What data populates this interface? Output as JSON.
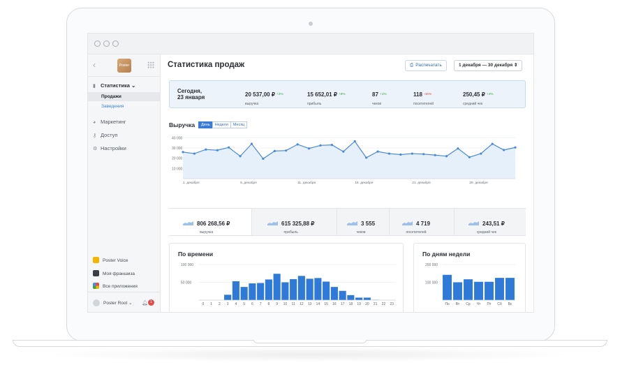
{
  "sidebar": {
    "back_glyph": "‹",
    "logo_text": "Poster",
    "nav": [
      {
        "label": "Статистика ⌄",
        "icon": "bar-chart-icon"
      },
      {
        "label": "Маркетинг",
        "icon": "marketing-icon"
      },
      {
        "label": "Доступ",
        "icon": "key-icon"
      },
      {
        "label": "Настройки",
        "icon": "gear-icon"
      }
    ],
    "sub_items": [
      "Продажи",
      "Заведения"
    ],
    "bottom": [
      {
        "label": "Poster Voice",
        "color": "#f5b400"
      },
      {
        "label": "Моя франшиза",
        "color": "#3a3f46"
      },
      {
        "label": "Все приложения",
        "color": "#4a8de0"
      }
    ],
    "user": "Poster Root ⌄",
    "notifications": "1"
  },
  "header": {
    "title": "Статистика продаж",
    "print_label": "Распечатать",
    "date_range": "1 декабря — 30 декабря ⇕"
  },
  "summary": {
    "today": [
      "Сегодня,",
      "23 января"
    ],
    "items": [
      {
        "value": "20 537,00 ₽",
        "pct": "+2%",
        "label": "выручка",
        "up": true
      },
      {
        "value": "15 652,01 ₽",
        "pct": "+8%",
        "label": "прибыль",
        "up": true
      },
      {
        "value": "87",
        "pct": "+1%",
        "label": "чеков",
        "up": true
      },
      {
        "value": "118",
        "pct": "-45%",
        "label": "посетителей",
        "up": false
      },
      {
        "value": "250,45 ₽",
        "pct": "+4%",
        "label": "средний чек",
        "up": true
      }
    ]
  },
  "revenue": {
    "title": "Выручка",
    "tabs": [
      "День",
      "Неделя",
      "Месяц"
    ],
    "active_tab": 0
  },
  "kpis": [
    {
      "value": "806 268,56 ₽",
      "label": "выручка"
    },
    {
      "value": "615 325,88 ₽",
      "label": "прибыль"
    },
    {
      "value": "3 555",
      "label": "чеков"
    },
    {
      "value": "4 719",
      "label": "посетителей"
    },
    {
      "value": "243,51 ₽",
      "label": "средний чек"
    }
  ],
  "colors": {
    "accent": "#3a7bd5",
    "line": "#4a8ad8",
    "area": "#e6f0fb",
    "bar": "#2f7ad8",
    "up": "#39a845",
    "down": "#e34b4b"
  },
  "chart_data": [
    {
      "type": "area",
      "title": "Выручка",
      "x": [
        1,
        2,
        3,
        4,
        5,
        6,
        7,
        8,
        9,
        10,
        11,
        12,
        13,
        14,
        15,
        16,
        17,
        18,
        19,
        20,
        21,
        22,
        23,
        24,
        25,
        26,
        27,
        28,
        29,
        30
      ],
      "values": [
        26000,
        24500,
        28500,
        27800,
        30500,
        22000,
        34000,
        19500,
        27000,
        27500,
        33500,
        29500,
        32500,
        33000,
        26500,
        36500,
        20500,
        26500,
        24500,
        23500,
        24500,
        24000,
        23000,
        22000,
        29500,
        21000,
        24500,
        34000,
        28000,
        30500
      ],
      "x_tick_labels": [
        "1. декабря",
        "6. декабря",
        "11. декабря",
        "16. декабря",
        "21. декабря",
        "26. декабря"
      ],
      "y_ticks": [
        "10 000",
        "20 000",
        "30 000",
        "40 000"
      ],
      "ylim": [
        0,
        45000
      ]
    },
    {
      "type": "bar",
      "title": "По времени",
      "categories": [
        "0",
        "1",
        "2",
        "3",
        "4",
        "5",
        "6",
        "7",
        "8",
        "9",
        "10",
        "11",
        "12",
        "13",
        "14",
        "15",
        "16",
        "17",
        "18",
        "19",
        "20",
        "21",
        "22",
        "23"
      ],
      "values": [
        0,
        0,
        0,
        15000,
        53000,
        37000,
        47000,
        48000,
        58000,
        74000,
        50000,
        59000,
        68000,
        60000,
        62000,
        52000,
        37000,
        26000,
        14000,
        7000,
        7000,
        1000,
        0,
        0
      ],
      "y_ticks": [
        "50 000",
        "100 000"
      ],
      "ylim": [
        0,
        100000
      ]
    },
    {
      "type": "bar",
      "title": "По дням недели",
      "categories": [
        "Пн",
        "Вт",
        "Ср",
        "Чт",
        "Пт",
        "Сб",
        "Вс"
      ],
      "values": [
        142000,
        100000,
        117000,
        103000,
        103000,
        125000,
        125000
      ],
      "y_ticks": [
        "100 000",
        "200 000"
      ],
      "ylim": [
        0,
        200000
      ]
    }
  ]
}
